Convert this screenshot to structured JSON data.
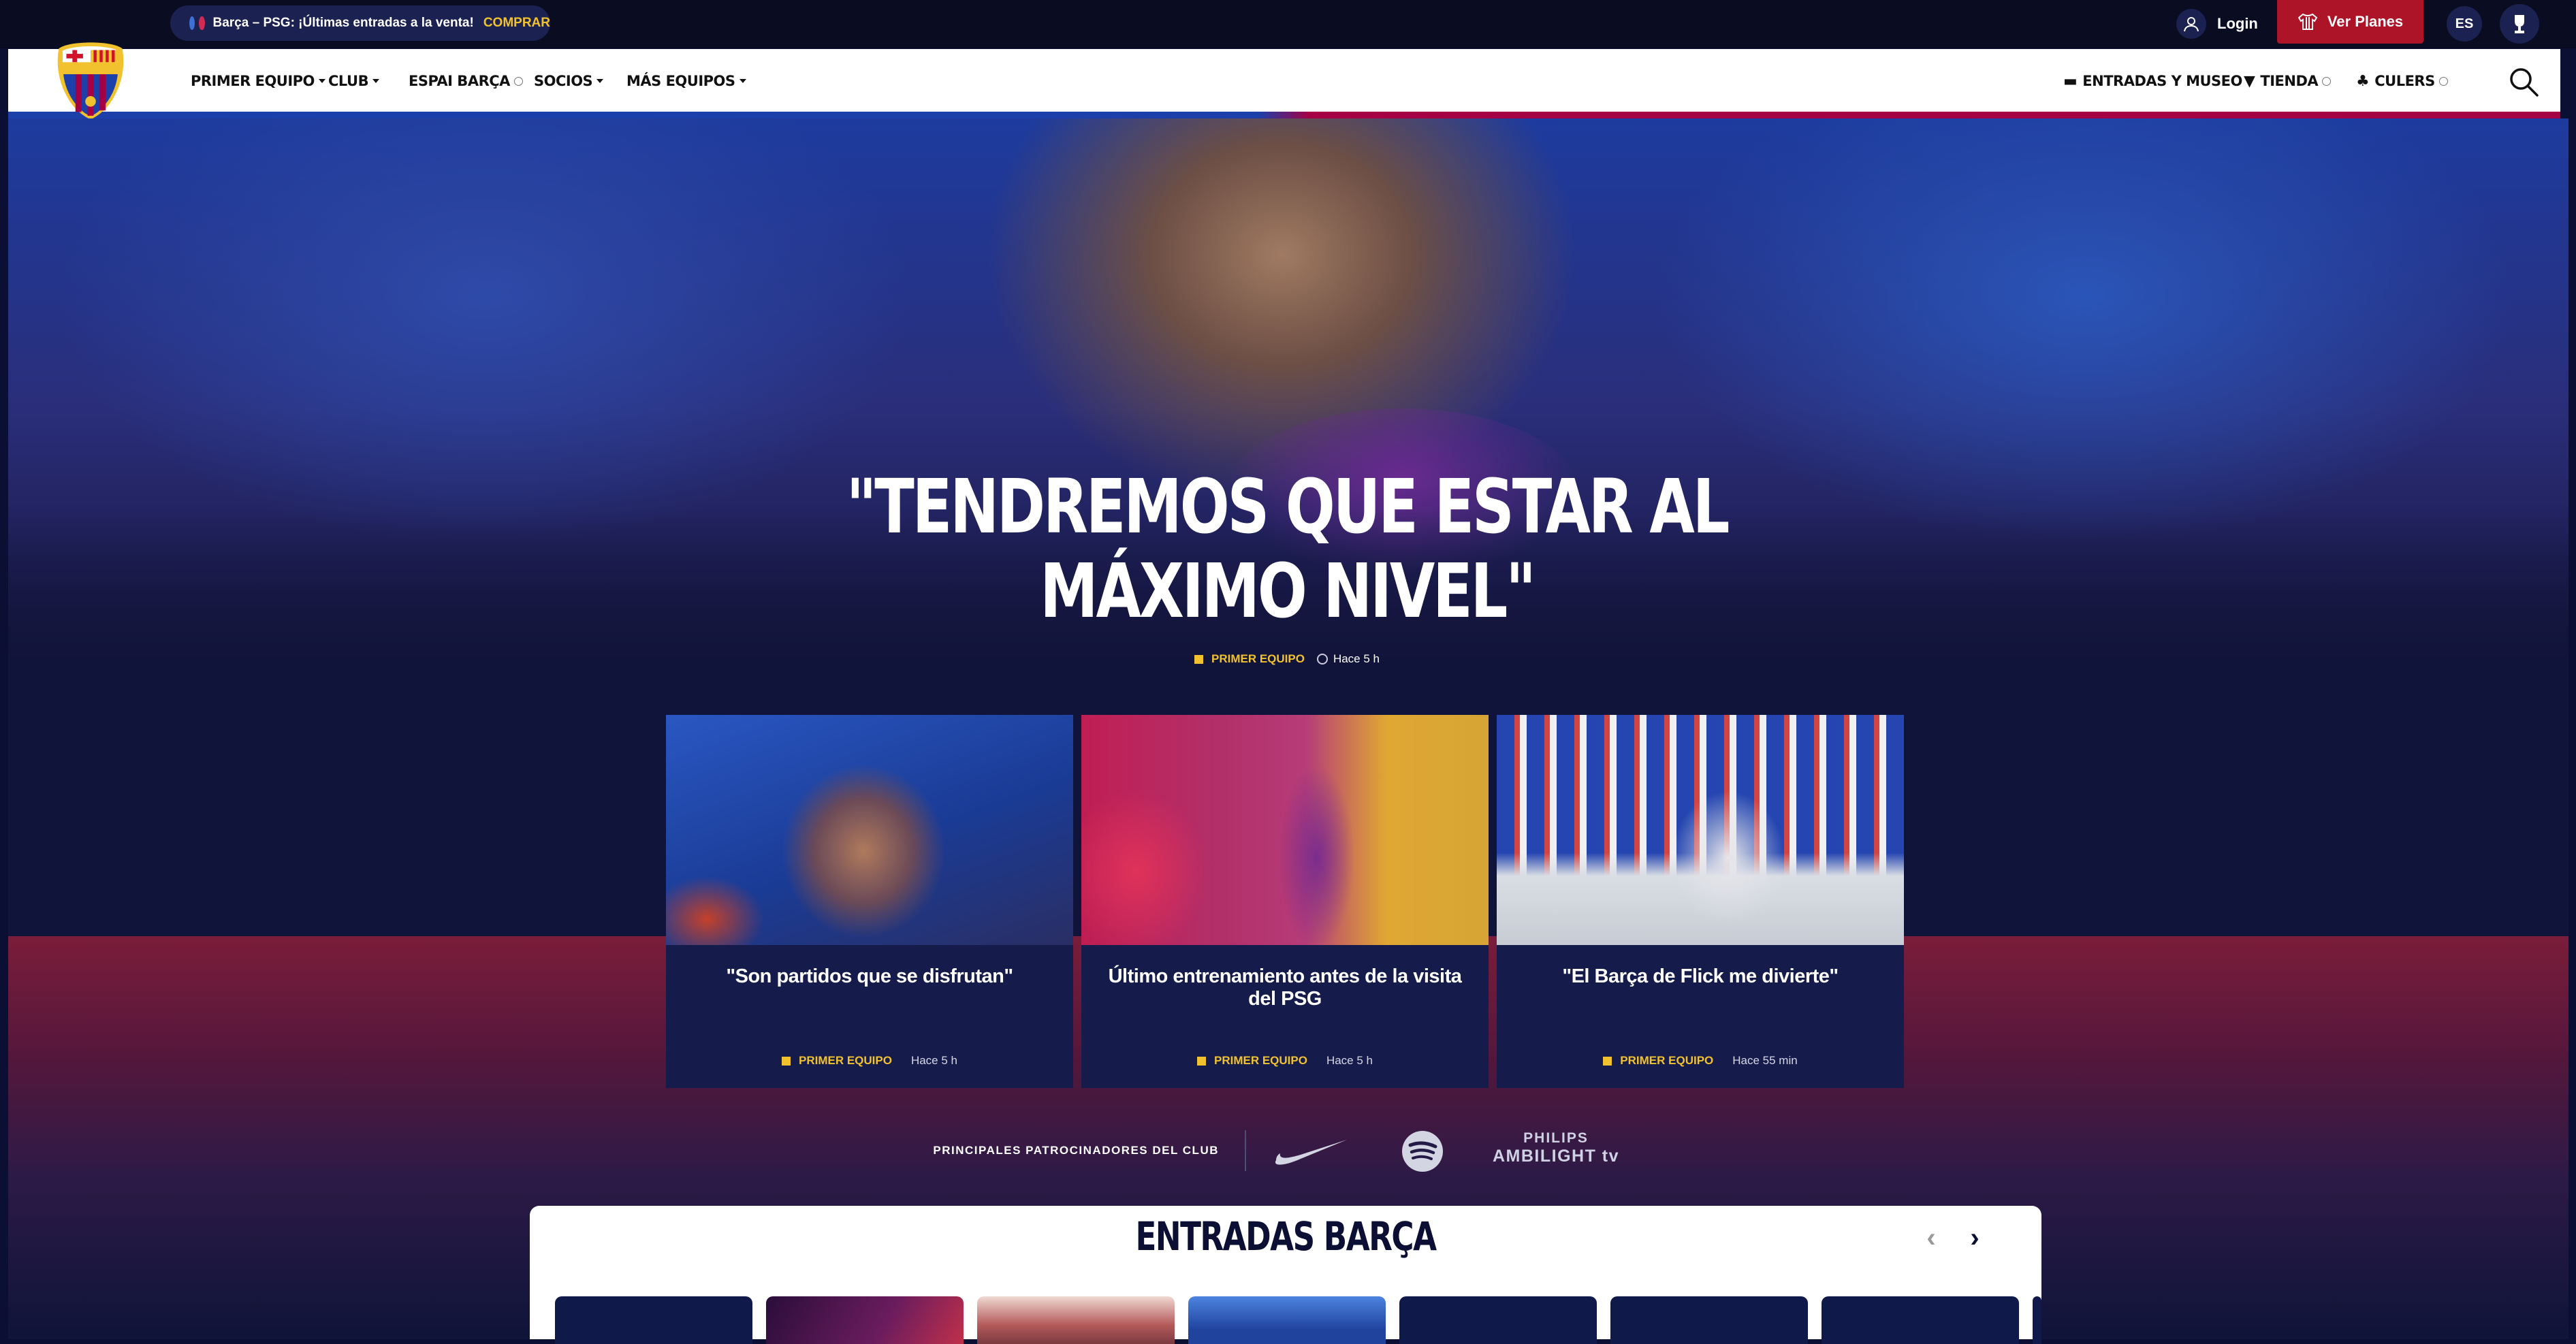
{
  "topbar": {
    "promo_text": "Barça – PSG: ¡Últimas entradas a la venta!",
    "promo_cta": "COMPRAR",
    "login_label": "Login",
    "plans_label": "Ver Planes",
    "language": "ES"
  },
  "nav": {
    "left_items": [
      {
        "label": "PRIMER EQUIPO"
      },
      {
        "label": "CLUB"
      },
      {
        "label": "ESPAI BARÇA"
      },
      {
        "label": "SOCIOS"
      },
      {
        "label": "MÁS EQUIPOS"
      }
    ],
    "right_items": [
      {
        "label": "ENTRADAS Y MUSEO"
      },
      {
        "label": "TIENDA"
      },
      {
        "label": "CULERS"
      }
    ]
  },
  "hero": {
    "title": "\"Tendremos que estar al máximo nivel\"",
    "category": "PRIMER EQUIPO",
    "time": "Hace 5 h"
  },
  "cards": [
    {
      "title": "\"Son partidos que se disfrutan\"",
      "category": "PRIMER EQUIPO",
      "time": "Hace 5 h"
    },
    {
      "title": "Último entrenamiento antes de la visita del PSG",
      "category": "PRIMER EQUIPO",
      "time": "Hace 5 h"
    },
    {
      "title": "\"El Barça de Flick me divierte\"",
      "category": "PRIMER EQUIPO",
      "time": "Hace 55 min"
    }
  ],
  "sponsors": {
    "label": "PRINCIPALES PATROCINADORES DEL CLUB",
    "philips_line1": "PHILIPS",
    "philips_line2": "AMBILIGHT tv"
  },
  "entradas": {
    "title": "ENTRADAS BARÇA"
  },
  "colors": {
    "navy": "#0b0f33",
    "accent_yellow": "#f2c22e",
    "plans_red": "#ad1428",
    "blaugrana_blue": "#1c3faa",
    "blaugrana_red": "#a50044"
  }
}
